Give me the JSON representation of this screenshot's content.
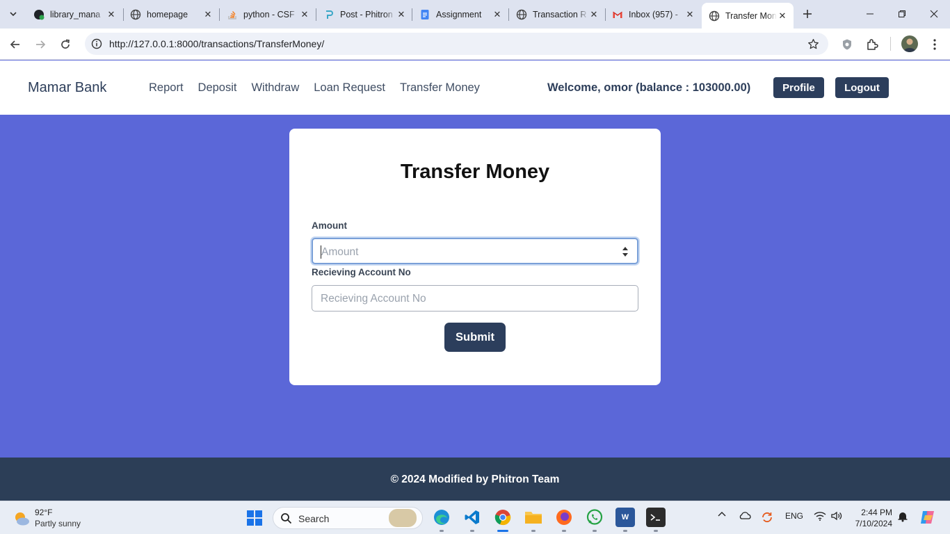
{
  "browser": {
    "tabs": [
      {
        "label": "library_mana",
        "icon": "github-icon"
      },
      {
        "label": "homepage",
        "icon": "globe-icon"
      },
      {
        "label": "python - CSF",
        "icon": "stackoverflow-icon"
      },
      {
        "label": "Post - Phitron",
        "icon": "phitron-icon"
      },
      {
        "label": "Assignment",
        "icon": "docs-icon"
      },
      {
        "label": "Transaction R",
        "icon": "globe-icon"
      },
      {
        "label": "Inbox (957) -",
        "icon": "gmail-icon"
      },
      {
        "label": "Transfer Mon",
        "icon": "globe-icon",
        "active": true
      }
    ],
    "url": "http://127.0.0.1:8000/transactions/TransferMoney/"
  },
  "site": {
    "brand": "Mamar Bank",
    "nav": [
      "Report",
      "Deposit",
      "Withdraw",
      "Loan Request",
      "Transfer Money"
    ],
    "welcome": "Welcome, omor (balance : 103000.00)",
    "profile_label": "Profile",
    "logout_label": "Logout"
  },
  "form": {
    "title": "Transfer Money",
    "amount_label": "Amount",
    "amount_value": "",
    "amount_placeholder": "Amount",
    "account_label": "Recieving Account No",
    "account_value": "",
    "account_placeholder": "Recieving Account No",
    "submit_label": "Submit"
  },
  "footer": {
    "text": "© 2024 Modified by Phitron Team"
  },
  "taskbar": {
    "weather_temp": "92°F",
    "weather_desc": "Partly sunny",
    "search_placeholder": "Search",
    "language": "ENG",
    "time": "2:44 PM",
    "date": "7/10/2024"
  },
  "colors": {
    "page_background": "#5b67d8",
    "primary_button": "#2c3e5c",
    "footer": "#2c3e57"
  }
}
